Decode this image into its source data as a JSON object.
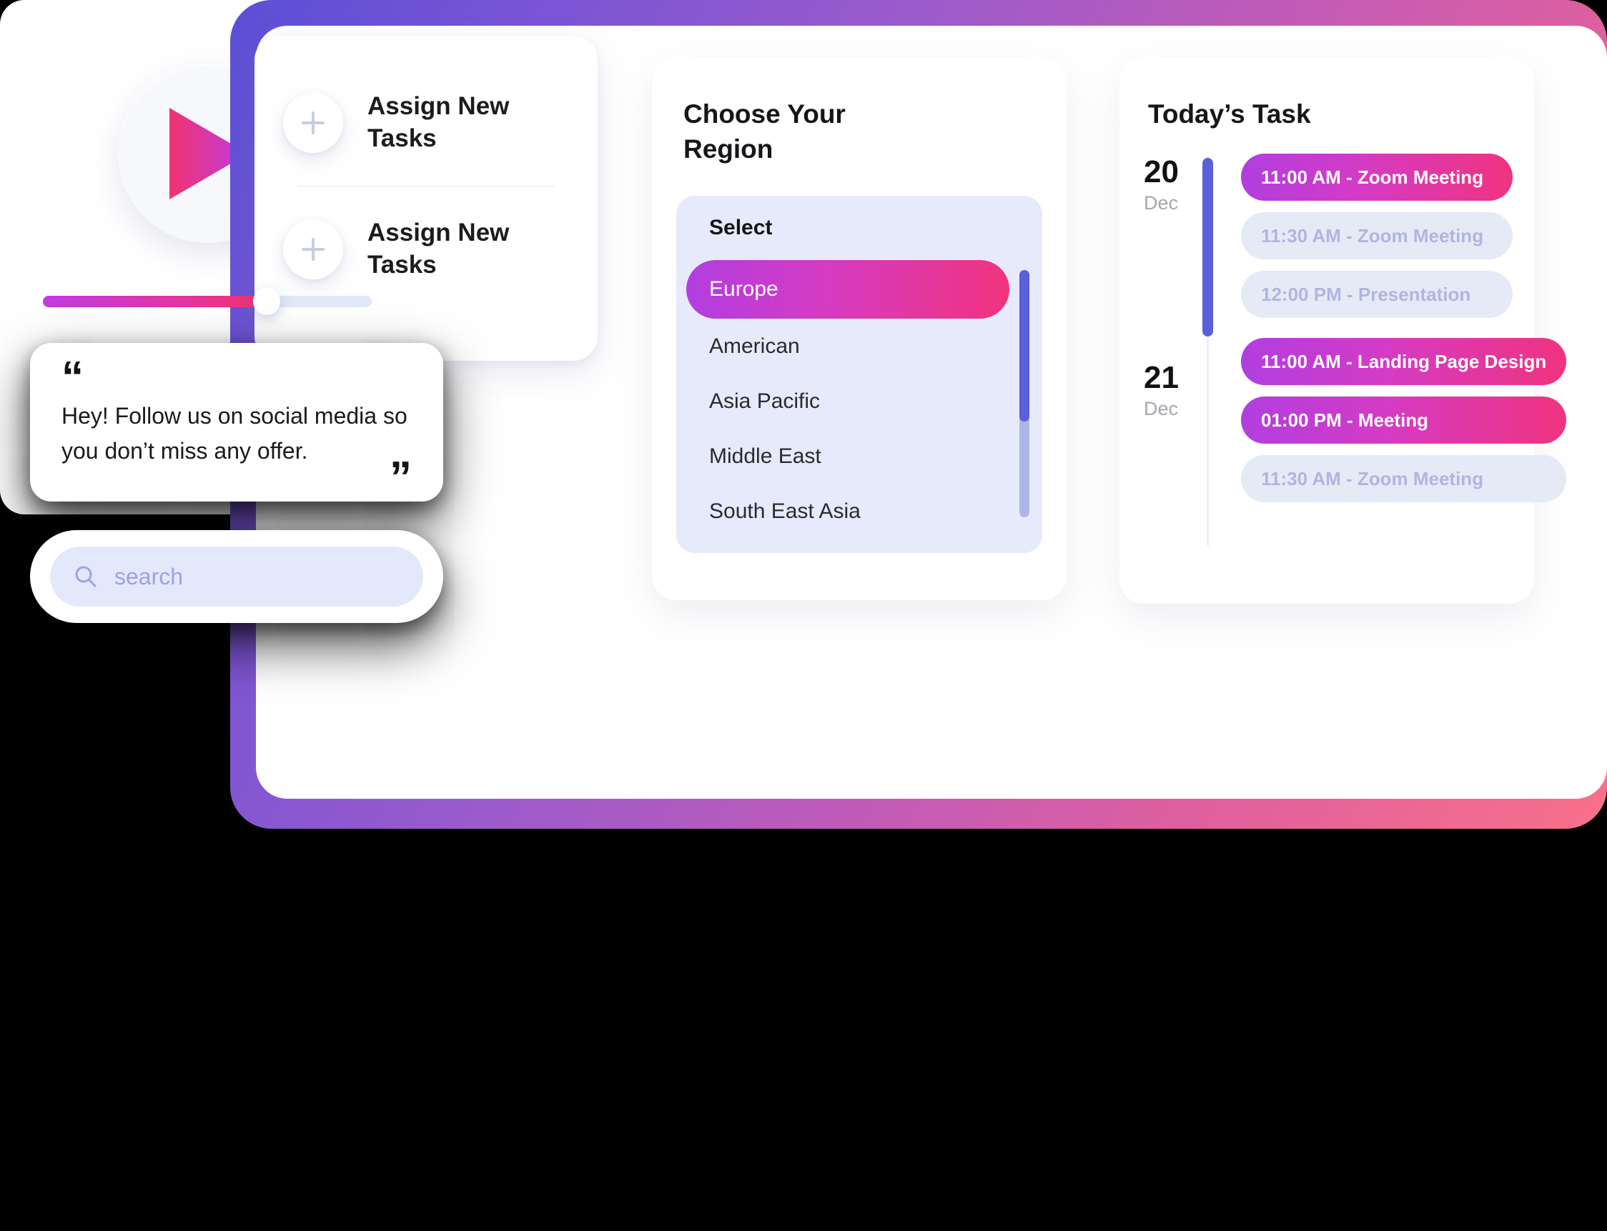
{
  "theme": {
    "frame_gradient_start": "#5B4FD6",
    "frame_gradient_mid": "#C05BB8",
    "frame_gradient_end": "#F9708A",
    "accent_purple": "#B13EE0",
    "accent_pink": "#F0337E",
    "indigo": "#5B5FDA",
    "lavender_panel": "#E7EAFA",
    "inactive_pill_bg": "#E6EAF7",
    "inactive_pill_text": "#AFB6DE"
  },
  "assign": {
    "rows": [
      {
        "label": "Assign New Tasks",
        "icon": "plus-icon"
      },
      {
        "label": "Assign New Tasks",
        "icon": "plus-icon"
      }
    ]
  },
  "region": {
    "title": "Choose Your Region",
    "select_label": "Select",
    "selected": "Europe",
    "options": [
      "Europe",
      "American",
      "Asia Pacific",
      "Middle East",
      "South East Asia"
    ]
  },
  "tasks": {
    "title": "Today’s Task",
    "days": [
      {
        "day": "20",
        "month": "Dec",
        "items": [
          {
            "label": "11:00 AM - Zoom Meeting",
            "state": "active"
          },
          {
            "label": "11:30 AM - Zoom Meeting",
            "state": "inactive"
          },
          {
            "label": "12:00 PM - Presentation",
            "state": "inactive"
          }
        ]
      },
      {
        "day": "21",
        "month": "Dec",
        "items": [
          {
            "label": "11:00 AM - Landing Page Design",
            "state": "active"
          },
          {
            "label": "01:00 PM - Meeting",
            "state": "active"
          },
          {
            "label": "11:30 AM - Zoom Meeting",
            "state": "inactive"
          }
        ]
      }
    ]
  },
  "player": {
    "hero_icon": "play-icon",
    "progress_percent": 68,
    "controls": [
      {
        "icon": "skip-previous-icon"
      },
      {
        "icon": "play-icon"
      },
      {
        "icon": "skip-next-icon"
      }
    ]
  },
  "quote": {
    "open_mark": "“",
    "close_mark": "”",
    "text": "Hey! Follow us on social media so you don’t miss any offer."
  },
  "search": {
    "placeholder": "search",
    "icon": "search-icon"
  }
}
